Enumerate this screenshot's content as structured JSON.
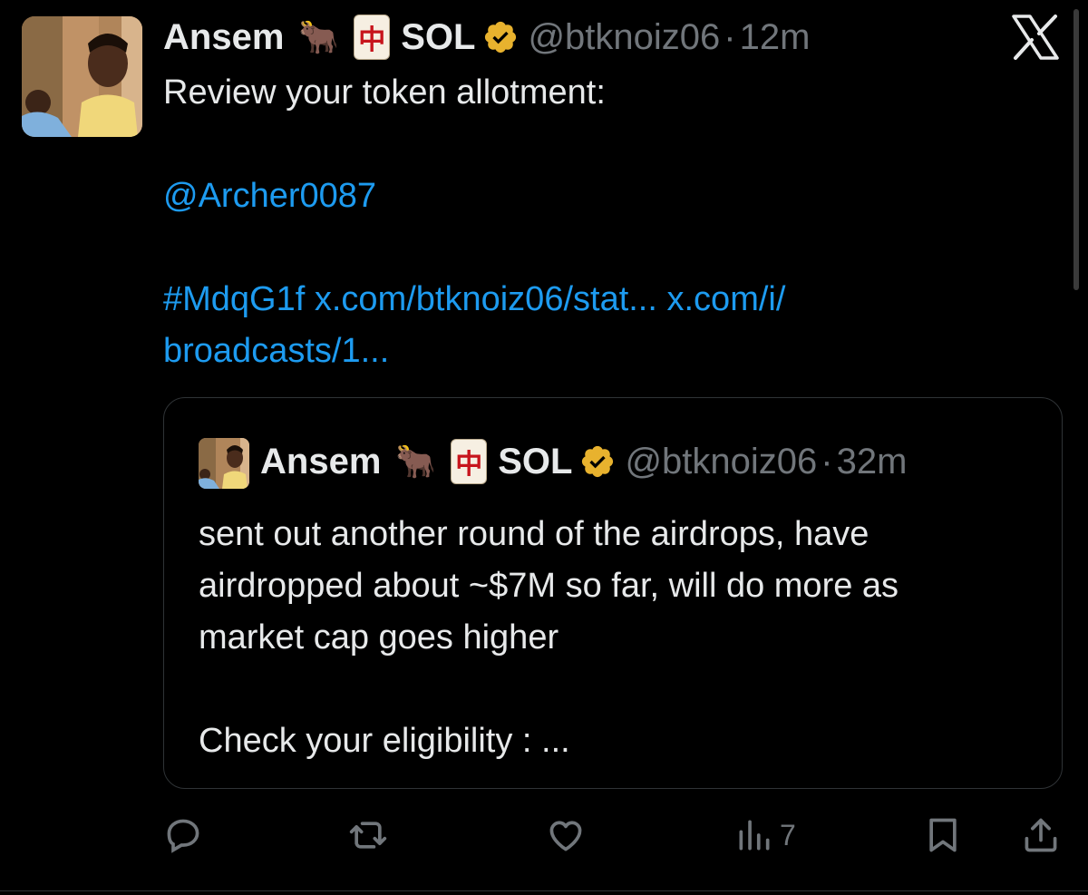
{
  "tweet": {
    "author_name": "Ansem",
    "emoji_ox": "🐂",
    "mahjong_char": "中",
    "name_suffix": "SOL",
    "handle": "@btknoiz06",
    "separator": "·",
    "time": "12m",
    "text_line1": "Review your token allotment:",
    "mention": "@Archer0087",
    "hashtag": "#MdqG1f",
    "link1": "x.com/btknoiz06/stat...",
    "link2": "x.com/i/",
    "link2_cont": "broadcasts/1..."
  },
  "quoted_tweet": {
    "author_name": "Ansem",
    "emoji_ox": "🐂",
    "mahjong_char": "中",
    "name_suffix": "SOL",
    "handle": "@btknoiz06",
    "separator": "·",
    "time": "32m",
    "line1": "sent out another round of the airdrops, have",
    "line2": "airdropped about ~$7M so far, will do more as",
    "line3": "market cap goes higher",
    "line4": "Check your eligibility : ..."
  },
  "actions": {
    "views_count": "7"
  },
  "icons": {
    "verified": "verified-badge-icon",
    "x_logo": "x-logo-icon",
    "reply": "reply-icon",
    "retweet": "retweet-icon",
    "like": "heart-icon",
    "views": "analytics-icon",
    "bookmark": "bookmark-icon",
    "share": "share-icon"
  },
  "colors": {
    "background": "#000000",
    "text": "#e7e9ea",
    "secondary": "#71767b",
    "link": "#1d9bf0",
    "verified_gold": "#e8b22e",
    "border": "#2f3336"
  }
}
